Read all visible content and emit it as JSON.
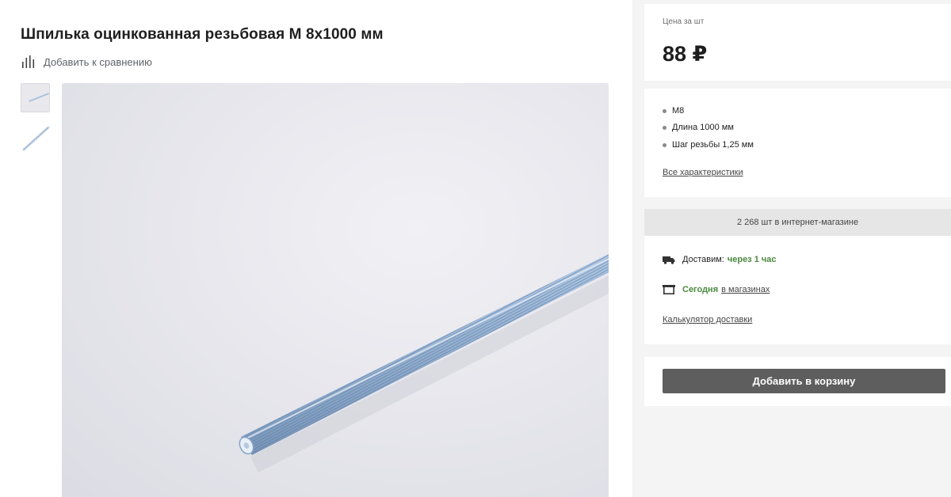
{
  "product": {
    "title": "Шпилька оцинкованная резьбовая М 8х1000 мм",
    "compare_label": "Добавить к сравнению",
    "compare_icon": "bar-chart-icon"
  },
  "gallery": {
    "thumbnails": [
      {
        "name": "thumbnail-1",
        "selected": true
      },
      {
        "name": "thumbnail-2",
        "selected": false
      }
    ]
  },
  "price": {
    "label": "Цена за шт",
    "value": "88 ₽"
  },
  "specs": {
    "items": [
      "M8",
      "Длина 1000 мм",
      "Шаг резьбы 1,25 мм"
    ],
    "all_link": "Все характеристики"
  },
  "availability": {
    "stock_text": "2 268 шт в интернет-магазине",
    "delivery_prefix": "Доставим:",
    "delivery_time": "через 1 час",
    "delivery_icon": "truck-icon",
    "store_today": "Сегодня",
    "store_link": "в магазинах",
    "store_icon": "store-icon",
    "calculator_link": "Калькулятор доставки"
  },
  "cart": {
    "button_label": "Добавить в корзину"
  },
  "colors": {
    "accent_green": "#4a8a3c",
    "cart_button": "#5e5e5e",
    "stock_bar": "#e6e6e6"
  }
}
